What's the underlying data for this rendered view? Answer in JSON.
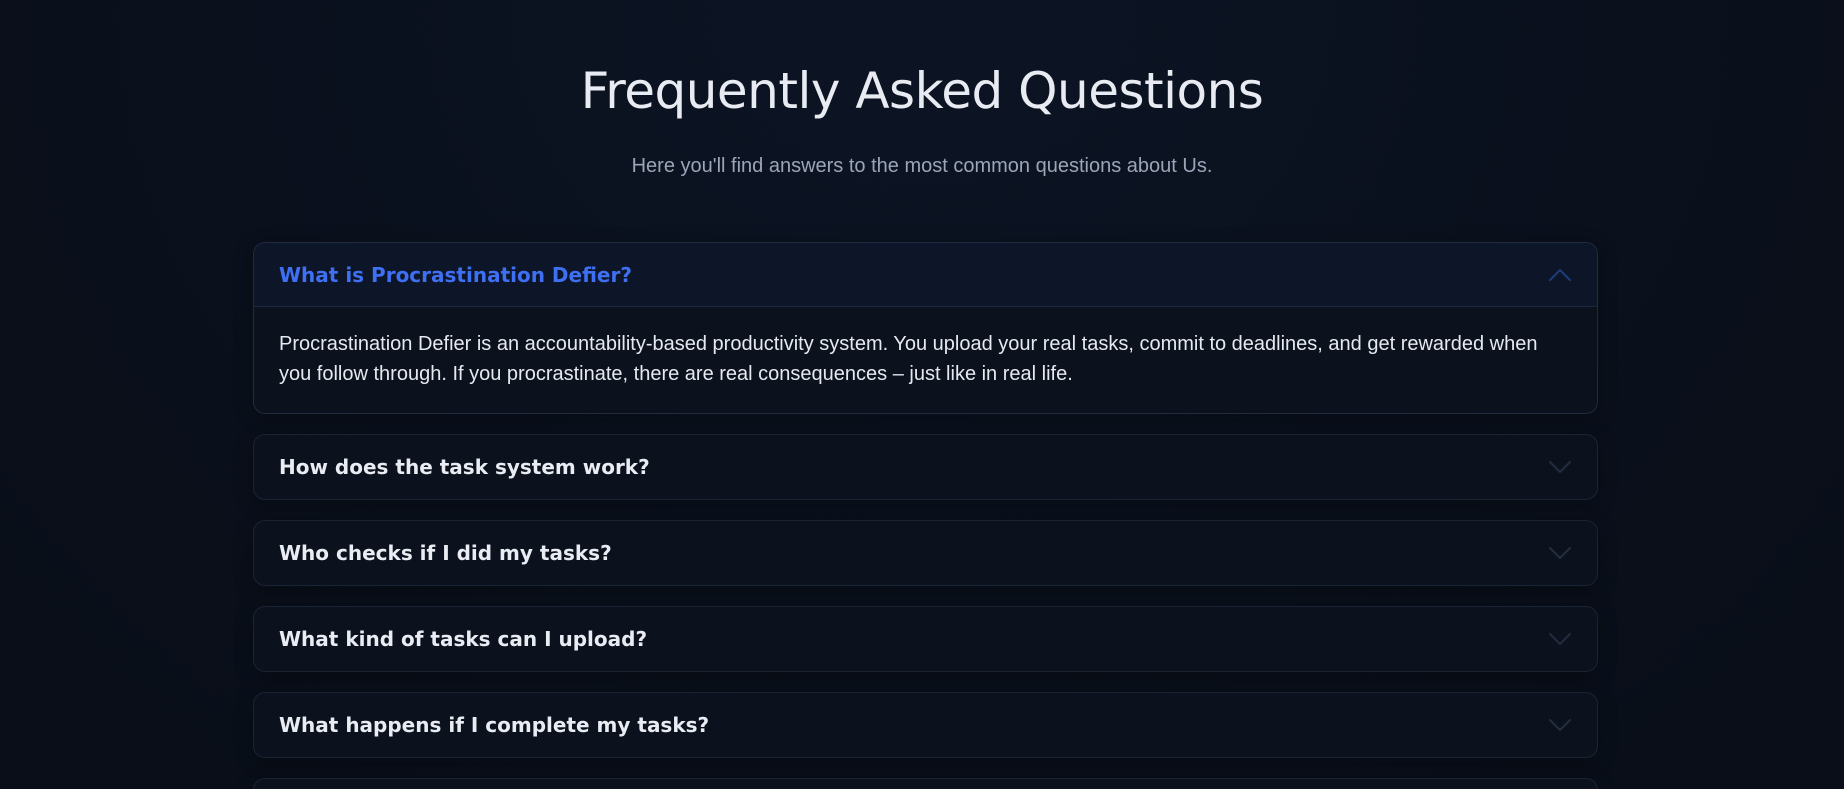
{
  "header": {
    "title": "Frequently Asked Questions",
    "subtitle": "Here you'll find answers to the most common questions about Us."
  },
  "faq": {
    "items": [
      {
        "question": "What is Procrastination Defier?",
        "answer": "Procrastination Defier is an accountability-based productivity system. You upload your real tasks, commit to deadlines, and get rewarded when you follow through. If you procrastinate, there are real consequences – just like in real life.",
        "expanded": true,
        "icon": "chevron-up-icon"
      },
      {
        "question": "How does the task system work?",
        "expanded": false,
        "icon": "chevron-down-icon"
      },
      {
        "question": "Who checks if I did my tasks?",
        "expanded": false,
        "icon": "chevron-down-icon"
      },
      {
        "question": "What kind of tasks can I upload?",
        "expanded": false,
        "icon": "chevron-down-icon"
      },
      {
        "question": "What happens if I complete my tasks?",
        "expanded": false,
        "icon": "chevron-down-icon"
      }
    ]
  },
  "colors": {
    "background": "#0a101c",
    "accent": "#3f6ff2",
    "card": "#0b111d",
    "border": "#1b2435"
  }
}
